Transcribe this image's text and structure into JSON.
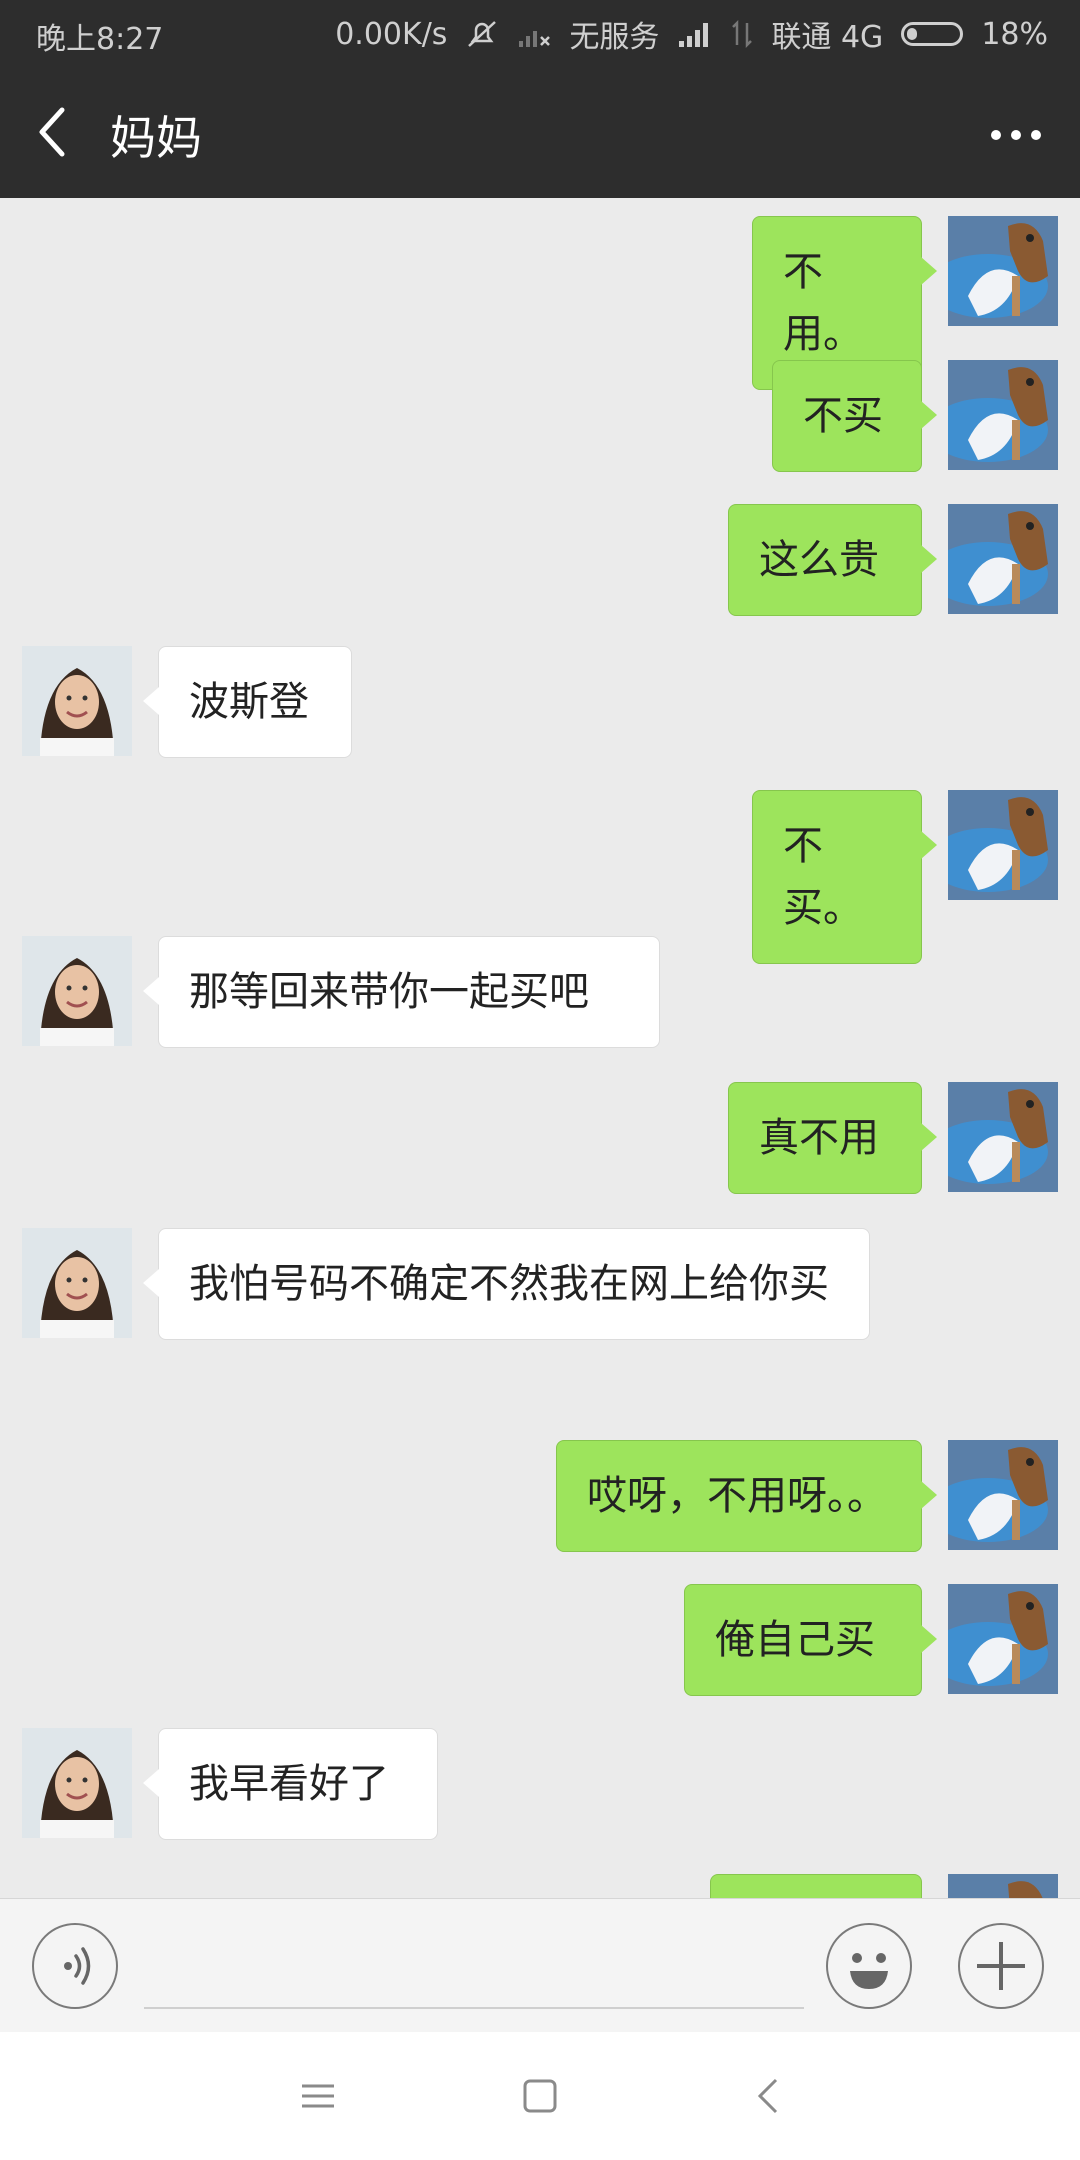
{
  "status_bar": {
    "time": "晚上8:27",
    "net_speed": "0.00K/s",
    "no_service": "无服务",
    "carrier": "联通 4G",
    "battery": "18%",
    "battery_level": 0.18
  },
  "header": {
    "title": "妈妈"
  },
  "messages": [
    {
      "side": "out",
      "text": "不用。"
    },
    {
      "side": "out",
      "text": "不买"
    },
    {
      "side": "out",
      "text": "这么贵"
    },
    {
      "side": "in",
      "text": "波斯登"
    },
    {
      "side": "out",
      "text": "不买。"
    },
    {
      "side": "in",
      "text": "那等回来带你一起买吧"
    },
    {
      "side": "out",
      "text": "真不用"
    },
    {
      "side": "in",
      "text": "我怕号码不确定不然我在网上给你买"
    },
    {
      "side": "out",
      "text": "哎呀，不用呀。。"
    },
    {
      "side": "out",
      "text": "俺自己买"
    },
    {
      "side": "in",
      "text": "我早看好了"
    }
  ],
  "colors": {
    "outgoing_bubble": "#9de45c",
    "incoming_bubble": "#ffffff",
    "header_bg": "#2d2d2d",
    "chat_bg": "#ebebeb"
  }
}
